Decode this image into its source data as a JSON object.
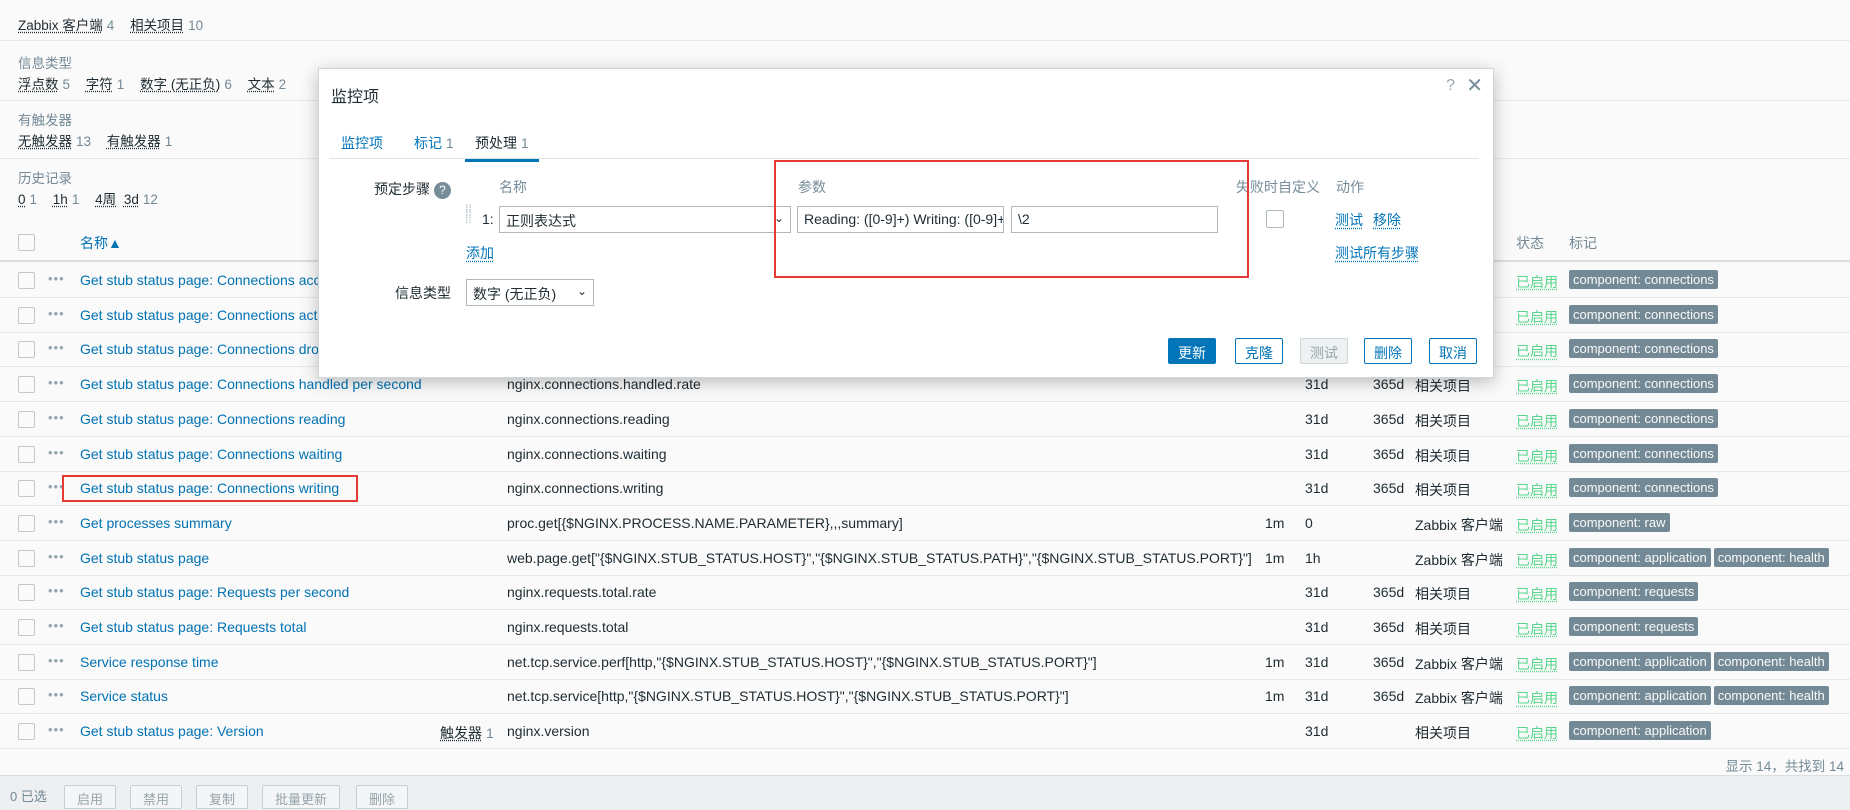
{
  "filters": {
    "row1": [
      {
        "label": "Zabbix 客户端",
        "count": "4"
      },
      {
        "label": "相关项目",
        "count": "10"
      }
    ],
    "info_type_heading": "信息类型",
    "info_types": [
      {
        "label": "浮点数",
        "count": "5"
      },
      {
        "label": "字符",
        "count": "1"
      },
      {
        "label": "数字 (无正负)",
        "count": "6"
      },
      {
        "label": "文本",
        "count": "2"
      }
    ],
    "triggers_heading": "有触发器",
    "triggers": [
      {
        "label": "无触发器",
        "count": "13"
      },
      {
        "label": "有触发器",
        "count": "1"
      }
    ],
    "history_heading": "历史记录",
    "history": [
      {
        "label": "0",
        "count": "1"
      },
      {
        "label": "1h",
        "count": "1"
      },
      {
        "label": "4周",
        "count": ""
      },
      {
        "label": "3d",
        "count": "12"
      }
    ]
  },
  "table": {
    "header_name": "名称▲",
    "header_status": "状态",
    "header_tags": "标记",
    "rows": [
      {
        "name": "Get stub status page: Connections acce",
        "trigger": "",
        "trigger_count": "",
        "key": "",
        "interval": "",
        "history": "",
        "trends": "",
        "type": "",
        "status": "已启用",
        "tags": [
          "component: connections"
        ]
      },
      {
        "name": "Get stub status page: Connections activ",
        "trigger": "",
        "trigger_count": "",
        "key": "",
        "interval": "",
        "history": "",
        "trends": "",
        "type": "",
        "status": "已启用",
        "tags": [
          "component: connections"
        ]
      },
      {
        "name": "Get stub status page: Connections drop",
        "trigger": "",
        "trigger_count": "",
        "key": "",
        "interval": "",
        "history": "",
        "trends": "",
        "type": "",
        "status": "已启用",
        "tags": [
          "component: connections"
        ]
      },
      {
        "name": "Get stub status page: Connections handled per second",
        "trigger": "",
        "trigger_count": "",
        "key": "nginx.connections.handled.rate",
        "interval": "",
        "history": "31d",
        "trends": "365d",
        "type": "相关项目",
        "status": "已启用",
        "tags": [
          "component: connections"
        ]
      },
      {
        "name": "Get stub status page: Connections reading",
        "trigger": "",
        "trigger_count": "",
        "key": "nginx.connections.reading",
        "interval": "",
        "history": "31d",
        "trends": "365d",
        "type": "相关项目",
        "status": "已启用",
        "tags": [
          "component: connections"
        ]
      },
      {
        "name": "Get stub status page: Connections waiting",
        "trigger": "",
        "trigger_count": "",
        "key": "nginx.connections.waiting",
        "interval": "",
        "history": "31d",
        "trends": "365d",
        "type": "相关项目",
        "status": "已启用",
        "tags": [
          "component: connections"
        ]
      },
      {
        "name": "Get stub status page: Connections writing",
        "trigger": "",
        "trigger_count": "",
        "key": "nginx.connections.writing",
        "interval": "",
        "history": "31d",
        "trends": "365d",
        "type": "相关项目",
        "status": "已启用",
        "tags": [
          "component: connections"
        ]
      },
      {
        "name": "Get processes summary",
        "trigger": "",
        "trigger_count": "",
        "key": "proc.get[{$NGINX.PROCESS.NAME.PARAMETER},,,summary]",
        "interval": "1m",
        "history": "0",
        "trends": "",
        "type": "Zabbix 客户端",
        "status": "已启用",
        "tags": [
          "component: raw"
        ]
      },
      {
        "name": "Get stub status page",
        "trigger": "",
        "trigger_count": "",
        "key": "web.page.get[\"{$NGINX.STUB_STATUS.HOST}\",\"{$NGINX.STUB_STATUS.PATH}\",\"{$NGINX.STUB_STATUS.PORT}\"]",
        "interval": "1m",
        "history": "1h",
        "trends": "",
        "type": "Zabbix 客户端",
        "status": "已启用",
        "tags": [
          "component: application",
          "component: health"
        ]
      },
      {
        "name": "Get stub status page: Requests per second",
        "trigger": "",
        "trigger_count": "",
        "key": "nginx.requests.total.rate",
        "interval": "",
        "history": "31d",
        "trends": "365d",
        "type": "相关项目",
        "status": "已启用",
        "tags": [
          "component: requests"
        ]
      },
      {
        "name": "Get stub status page: Requests total",
        "trigger": "",
        "trigger_count": "",
        "key": "nginx.requests.total",
        "interval": "",
        "history": "31d",
        "trends": "365d",
        "type": "相关项目",
        "status": "已启用",
        "tags": [
          "component: requests"
        ]
      },
      {
        "name": "Service response time",
        "trigger": "",
        "trigger_count": "",
        "key": "net.tcp.service.perf[http,\"{$NGINX.STUB_STATUS.HOST}\",\"{$NGINX.STUB_STATUS.PORT}\"]",
        "interval": "1m",
        "history": "31d",
        "trends": "365d",
        "type": "Zabbix 客户端",
        "status": "已启用",
        "tags": [
          "component: application",
          "component: health"
        ]
      },
      {
        "name": "Service status",
        "trigger": "",
        "trigger_count": "",
        "key": "net.tcp.service[http,\"{$NGINX.STUB_STATUS.HOST}\",\"{$NGINX.STUB_STATUS.PORT}\"]",
        "interval": "1m",
        "history": "31d",
        "trends": "365d",
        "type": "Zabbix 客户端",
        "status": "已启用",
        "tags": [
          "component: application",
          "component: health"
        ]
      },
      {
        "name": "Get stub status page: Version",
        "trigger": "触发器",
        "trigger_count": "1",
        "key": "nginx.version",
        "interval": "",
        "history": "31d",
        "trends": "",
        "type": "相关项目",
        "status": "已启用",
        "tags": [
          "component: application"
        ]
      }
    ],
    "footer_count": "显示 14，共找到 14"
  },
  "bottombar": {
    "selected": "0 已选",
    "buttons": [
      "启用",
      "禁用",
      "复制",
      "批量更新",
      "删除"
    ]
  },
  "modal": {
    "title": "监控项",
    "help": "?",
    "close": "✕",
    "tabs": [
      {
        "label": "监控项",
        "count": ""
      },
      {
        "label": "标记",
        "count": "1"
      },
      {
        "label": "预处理",
        "count": "1"
      }
    ],
    "preprocessing_label": "预定步骤",
    "col_name": "名称",
    "col_params": "参数",
    "col_custom_on_fail": "失败时自定义",
    "col_actions": "动作",
    "step_number": "1:",
    "step_type": "正则表达式",
    "step_param1": "Reading: ([0-9]+) Writing: ([0-9]+",
    "step_param2": "\\2",
    "action_test": "测试",
    "action_remove": "移除",
    "add_link": "添加",
    "test_all": "测试所有步骤",
    "info_type_label": "信息类型",
    "info_type_value": "数字 (无正负)",
    "buttons": {
      "update": "更新",
      "clone": "克隆",
      "test": "测试",
      "delete": "删除",
      "cancel": "取消"
    }
  }
}
